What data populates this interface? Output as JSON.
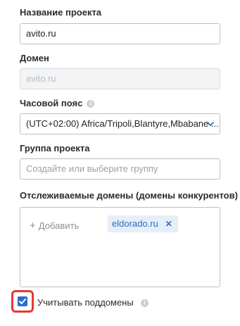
{
  "project_name": {
    "label": "Название проекта",
    "value": "avito.ru"
  },
  "domain": {
    "label": "Домен",
    "value": "avito.ru"
  },
  "timezone": {
    "label": "Часовой пояс",
    "value": "(UTC+02:00) Africa/Tripoli,Blantyre,Mbabane ..."
  },
  "project_group": {
    "label": "Группа проекта",
    "placeholder": "Создайте или выберите группу"
  },
  "tracked_domains": {
    "label": "Отслеживаемые домены (домены конкурентов)",
    "add_label": "Добавить",
    "chips": [
      "eldorado.ru"
    ]
  },
  "subdomains": {
    "label": "Учитывать поддомены",
    "checked": true
  },
  "colors": {
    "accent": "#2a6fc9",
    "highlight": "#e53935"
  },
  "icons": {
    "info": "info-icon",
    "chevron": "chevron-down-icon",
    "plus": "plus-icon",
    "remove": "close-icon",
    "check": "checkmark-icon"
  }
}
